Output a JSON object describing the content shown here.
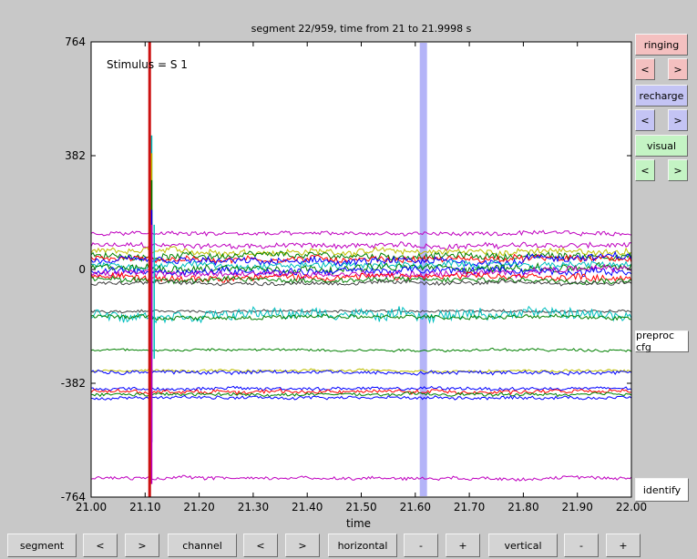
{
  "colors": {
    "ringing": "#f4c0c0",
    "recharge": "#c4c4f4",
    "visual": "#c4f4c4",
    "stimulus_line": "#cc1111",
    "artifact_band": "#b4b4f8",
    "trace_colors": [
      "#0000ff",
      "#008000",
      "#ff0000",
      "#00bfbf",
      "#bf00bf",
      "#bfbf00",
      "#404040"
    ]
  },
  "chart_data": {
    "type": "line",
    "title": "segment 22/959, time from 21 to 21.9998 s",
    "xlabel": "time",
    "ylabel": "",
    "xlim": [
      21.0,
      22.0
    ],
    "ylim": [
      -764,
      764
    ],
    "xticks": [
      "21.00",
      "21.10",
      "21.20",
      "21.30",
      "21.40",
      "21.50",
      "21.60",
      "21.70",
      "21.80",
      "21.90",
      "22.00"
    ],
    "yticks": [
      "764",
      "382",
      "0",
      "-382",
      "-764"
    ],
    "annotation": "Stimulus = S  1",
    "stimulus_time": 21.11,
    "artifact_marker_time": 21.615,
    "channel_offsets": [
      {
        "offset": 80,
        "color": "#bf00bf",
        "noise": 10
      },
      {
        "offset": 60,
        "color": "#bfbf00",
        "noise": 12
      },
      {
        "offset": 45,
        "color": "#008000",
        "noise": 12
      },
      {
        "offset": 35,
        "color": "#ff0000",
        "noise": 12
      },
      {
        "offset": 25,
        "color": "#0000ff",
        "noise": 14
      },
      {
        "offset": 15,
        "color": "#00bfbf",
        "noise": 12
      },
      {
        "offset": 5,
        "color": "#008000",
        "noise": 14
      },
      {
        "offset": -5,
        "color": "#0000ff",
        "noise": 14
      },
      {
        "offset": -15,
        "color": "#bf00bf",
        "noise": 12
      },
      {
        "offset": -25,
        "color": "#ff0000",
        "noise": 12
      },
      {
        "offset": -35,
        "color": "#008000",
        "noise": 10
      },
      {
        "offset": -45,
        "color": "#404040",
        "noise": 8
      },
      {
        "offset": 120,
        "color": "#bf00bf",
        "noise": 8
      },
      {
        "offset": -140,
        "color": "#404040",
        "noise": 5
      },
      {
        "offset": -150,
        "color": "#00bfbf",
        "noise": 20
      },
      {
        "offset": -160,
        "color": "#008000",
        "noise": 8
      },
      {
        "offset": -270,
        "color": "#008000",
        "noise": 5
      },
      {
        "offset": -340,
        "color": "#bfbf00",
        "noise": 5
      },
      {
        "offset": -345,
        "color": "#0000ff",
        "noise": 7
      },
      {
        "offset": -400,
        "color": "#0000ff",
        "noise": 6
      },
      {
        "offset": -410,
        "color": "#ff0000",
        "noise": 7
      },
      {
        "offset": -420,
        "color": "#008000",
        "noise": 6
      },
      {
        "offset": -430,
        "color": "#0000ff",
        "noise": 6
      },
      {
        "offset": -700,
        "color": "#bf00bf",
        "noise": 6
      }
    ]
  },
  "side": {
    "ringing": {
      "label": "ringing",
      "prev": "<",
      "next": ">"
    },
    "recharge": {
      "label": "recharge",
      "prev": "<",
      "next": ">"
    },
    "visual": {
      "label": "visual",
      "prev": "<",
      "next": ">"
    },
    "preproc": "preproc cfg",
    "identify": "identify"
  },
  "bottom": {
    "segment": "segment",
    "segment_prev": "<",
    "segment_next": ">",
    "channel": "channel",
    "channel_prev": "<",
    "channel_next": ">",
    "horizontal": "horizontal",
    "horizontal_minus": "-",
    "horizontal_plus": "+",
    "vertical": "vertical",
    "vertical_minus": "-",
    "vertical_plus": "+"
  }
}
